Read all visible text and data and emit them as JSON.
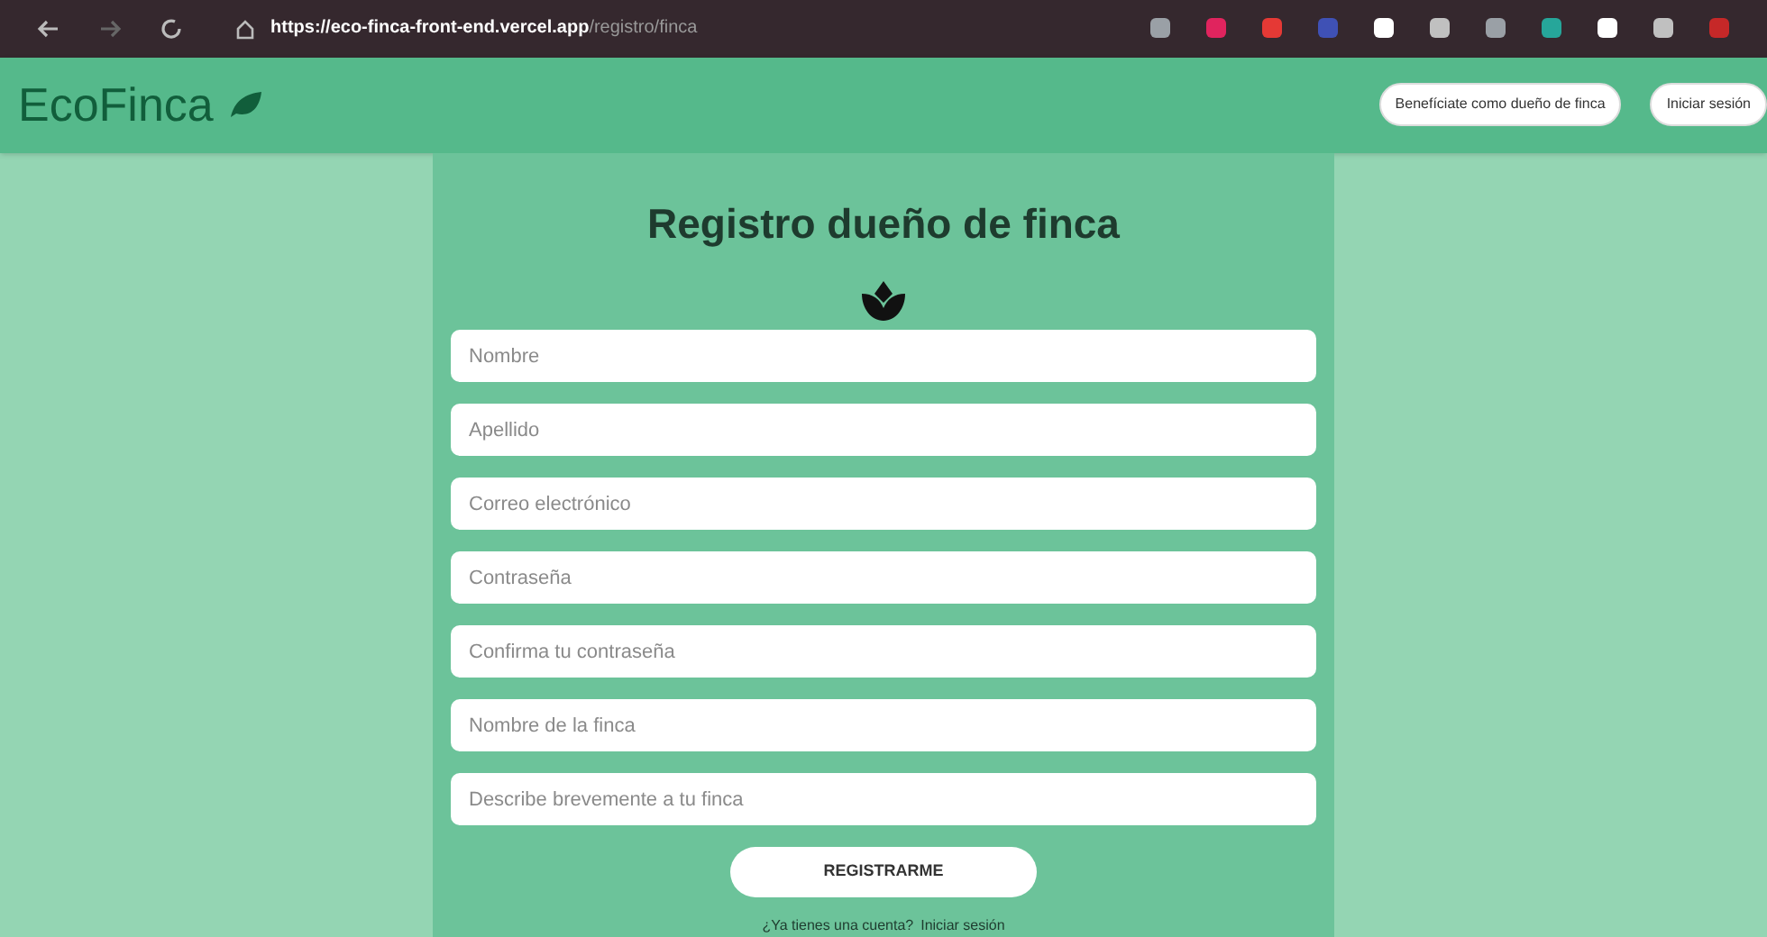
{
  "browser": {
    "url_host": "https://eco-finca-front-end.vercel.app",
    "url_path": "/registro/finca"
  },
  "header": {
    "brand": "EcoFinca",
    "buttons": [
      "Benefíciate como dueño de finca",
      "Iniciar sesión"
    ]
  },
  "form": {
    "title": "Registro dueño de finca",
    "fields": [
      {
        "placeholder": "Nombre"
      },
      {
        "placeholder": "Apellido"
      },
      {
        "placeholder": "Correo electrónico"
      },
      {
        "placeholder": "Contraseña"
      },
      {
        "placeholder": "Confirma tu contraseña"
      },
      {
        "placeholder": "Nombre de la finca"
      },
      {
        "placeholder": "Describe brevemente a tu finca"
      }
    ],
    "submit": "REGISTRARME",
    "footer_text": "¿Ya tienes una cuenta?",
    "footer_link": "Iniciar sesión"
  }
}
